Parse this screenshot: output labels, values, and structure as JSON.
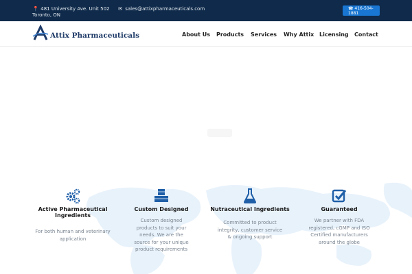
{
  "topbar": {
    "address_icon": "map-pin-icon",
    "address": "481 University Ave. Unit 502 Toronto, ON",
    "email_icon": "envelope-icon",
    "email": "sales@attixpharmaceuticals.com",
    "phone_icon": "phone-icon",
    "phone": "416-504-1881",
    "bg_color": "#0f2a4a",
    "accent_color": "#1976d2"
  },
  "header": {
    "logo_text": "Attix Pharmaceuticals",
    "nav": [
      {
        "label": "About Us"
      },
      {
        "label": "Products"
      },
      {
        "label": "Services"
      },
      {
        "label": "Why Attix"
      },
      {
        "label": "Licensing"
      },
      {
        "label": "Contact"
      }
    ]
  },
  "features": [
    {
      "icon": "gears-icon",
      "title": "Active Pharmaceutical Ingredients",
      "desc": "For both human and veterinary application"
    },
    {
      "icon": "cubes-icon",
      "title": "Custom Designed",
      "desc": "Custom designed products to suit your needs.  We are the source for your unique product requirements"
    },
    {
      "icon": "flask-icon",
      "title": "Nutraceutical Ingredients",
      "desc": "Committed to product integrity, customer service & ongoing support"
    },
    {
      "icon": "checkbox-icon",
      "title": "Guaranteed",
      "desc": "We partner with FDA registered, cGMP and ISO Certified manufacturers around the globe"
    }
  ],
  "colors": {
    "icon_blue": "#1f5fa8",
    "map_tint": "#e8f2fb"
  }
}
